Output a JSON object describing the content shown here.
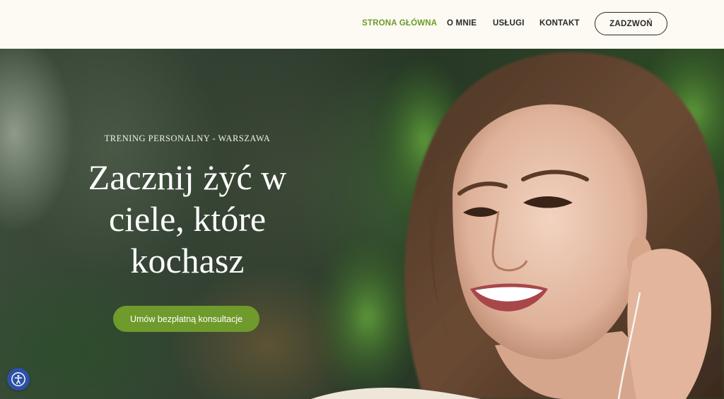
{
  "nav": {
    "items": [
      {
        "label": "STRONA GŁÓWNA",
        "active": true
      },
      {
        "label": "O MNIE",
        "active": false
      },
      {
        "label": "USŁUGI",
        "active": false
      },
      {
        "label": "KONTAKT",
        "active": false
      }
    ],
    "call_label": "ZADZWOŃ"
  },
  "hero": {
    "eyebrow": "TRENING PERSONALNY - WARSZAWA",
    "headline_lines": [
      "Zacznij żyć w",
      "ciele, które",
      "kochasz"
    ],
    "cta_label": "Umów bezpłatną konsultacje"
  },
  "accessibility": {
    "icon": "accessibility-icon"
  },
  "colors": {
    "accent": "#6f9a2c",
    "header_bg": "#fcfaf2",
    "text_dark": "#2a2a24",
    "accessibility_bg": "#2c51a6"
  }
}
